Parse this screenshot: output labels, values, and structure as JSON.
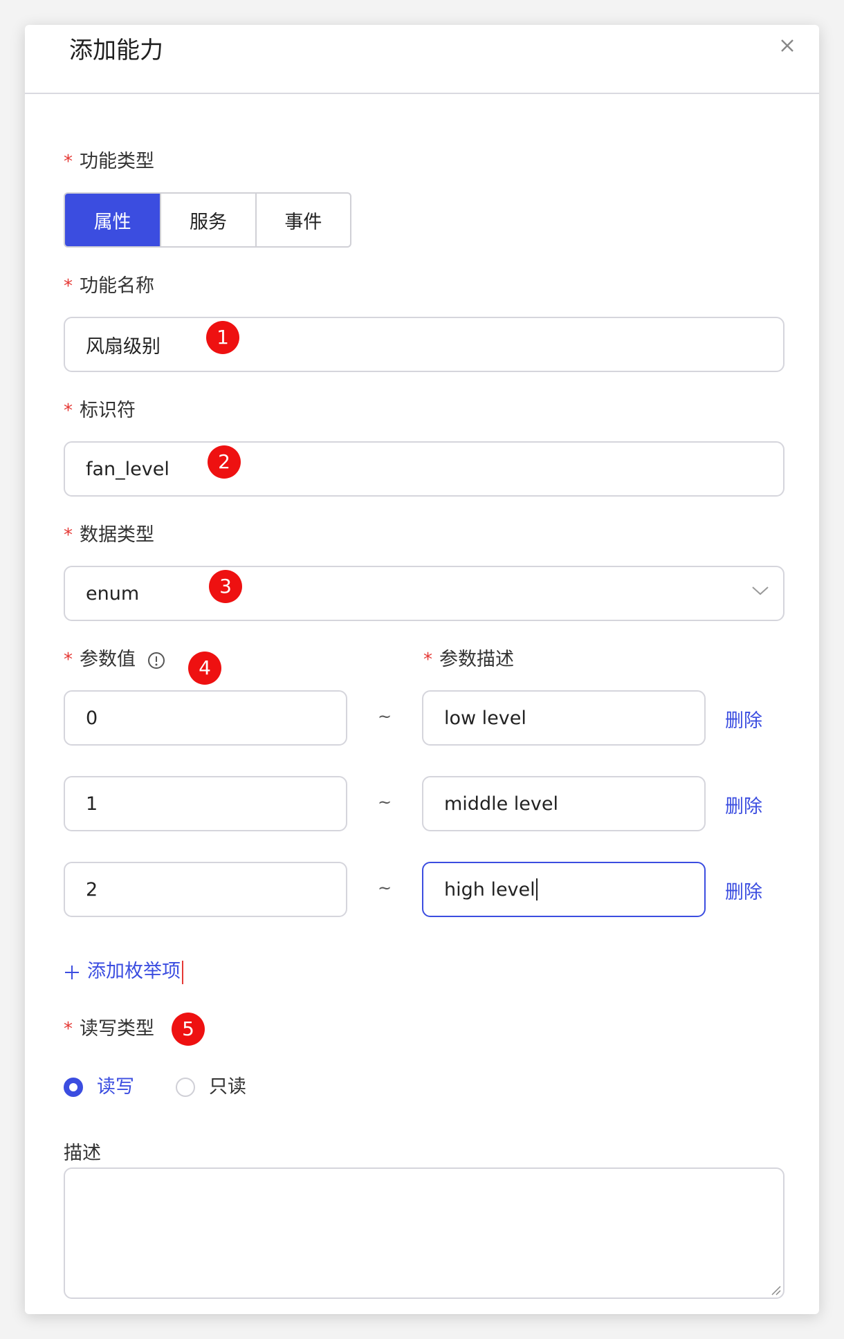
{
  "dialog": {
    "title": "添加能力"
  },
  "form": {
    "required_mark": "*",
    "function_type": {
      "label": "功能类型",
      "options": [
        "属性",
        "服务",
        "事件"
      ],
      "selected": "属性"
    },
    "function_name": {
      "label": "功能名称",
      "value": "风扇级别"
    },
    "identifier": {
      "label": "标识符",
      "value": "fan_level"
    },
    "data_type": {
      "label": "数据类型",
      "value": "enum"
    },
    "enum": {
      "value_label": "参数值",
      "desc_label": "参数描述",
      "separator": "~",
      "delete_label": "删除",
      "rows": [
        {
          "value": "0",
          "desc": "low level"
        },
        {
          "value": "1",
          "desc": "middle level"
        },
        {
          "value": "2",
          "desc": "high level"
        }
      ],
      "add_label": "添加枚举项"
    },
    "rw_type": {
      "label": "读写类型",
      "options": [
        "读写",
        "只读"
      ],
      "selected": "读写"
    },
    "description": {
      "label": "描述",
      "value": ""
    }
  },
  "annotations": [
    "1",
    "2",
    "3",
    "4",
    "5"
  ],
  "colors": {
    "primary": "#3b4de0",
    "required": "#e53935",
    "badge": "#ee1111"
  }
}
